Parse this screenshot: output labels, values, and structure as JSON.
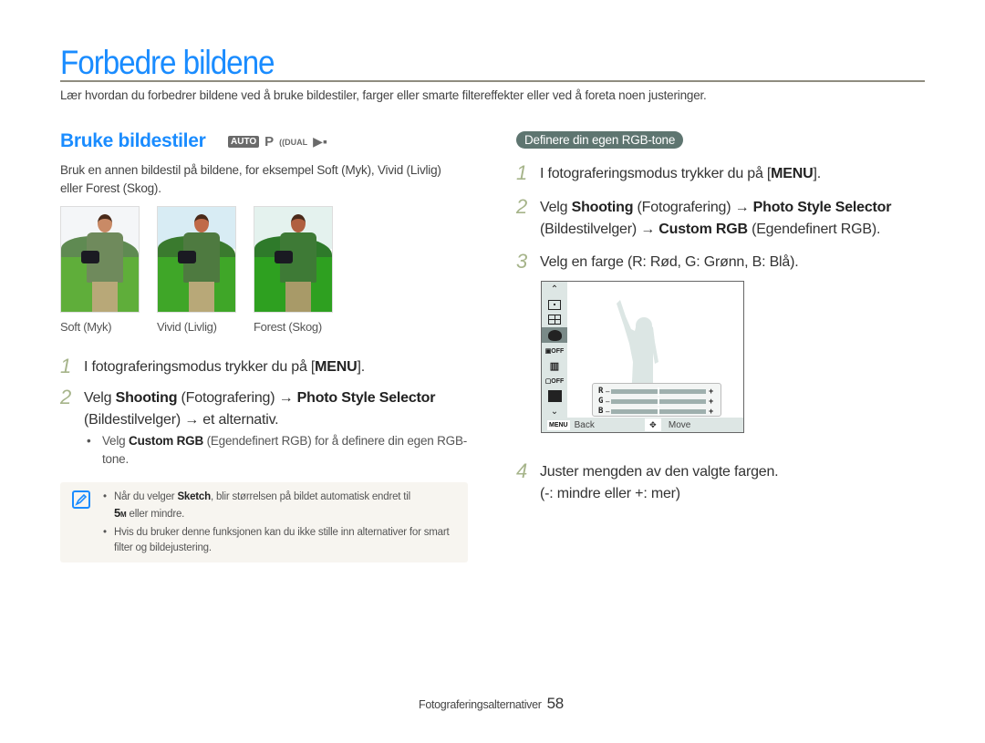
{
  "page": {
    "title": "Forbedre bildene",
    "intro": "Lær hvordan du forbedrer bildene ved å bruke bildestiler, farger eller smarte filtereffekter eller ved å foreta noen justeringer."
  },
  "section": {
    "title": "Bruke bildestiler",
    "mode_icons": [
      "AUTO",
      "P",
      "DUAL",
      "movie"
    ],
    "description": "Bruk en annen bildestil på bildene, for eksempel Soft (Myk), Vivid (Livlig) eller Forest (Skog).",
    "thumbnails": [
      {
        "caption": "Soft (Myk)",
        "style": "soft"
      },
      {
        "caption": "Vivid (Livlig)",
        "style": "vivid"
      },
      {
        "caption": "Forest (Skog)",
        "style": "forest"
      }
    ],
    "steps": [
      {
        "num": "1",
        "pre": "I fotograferingsmodus trykker du på [",
        "bold": "MENU",
        "post": "]."
      },
      {
        "num": "2",
        "a": "Velg ",
        "b": "Shooting",
        "c": " (Fotografering) → ",
        "d": "Photo Style Selector",
        "e": "(Bildestilvelger) → et alternativ."
      }
    ],
    "bullet": {
      "a": "Velg ",
      "b": "Custom RGB",
      "c": " (Egendefinert RGB) for å definere din egen RGB-tone."
    },
    "notes": [
      {
        "a": "Når du velger ",
        "b": "Sketch",
        "c": ", blir størrelsen på bildet automatisk endret til ",
        "res": "5",
        "res_unit": "M",
        "d": " eller mindre."
      },
      {
        "a": "Hvis du bruker denne funksjonen kan du ikke stille inn alternativer for smart filter og bildejustering."
      }
    ]
  },
  "rgb_section": {
    "pill": "Definere din egen RGB-tone",
    "steps": [
      {
        "num": "1",
        "pre": "I fotograferingsmodus trykker du på [",
        "bold": "MENU",
        "post": "]."
      },
      {
        "num": "2",
        "a": "Velg ",
        "b": "Shooting",
        "c": " (Fotografering) → ",
        "d": "Photo Style Selector",
        "e": "(Bildestilvelger) → ",
        "f": "Custom RGB",
        "g": " (Egendefinert RGB)."
      },
      {
        "num": "3",
        "text": "Velg en farge (R: Rød, G: Grønn, B: Blå)."
      },
      {
        "num": "4",
        "line1": "Juster mengden av den valgte fargen.",
        "line2": "(-: mindre eller +: mer)"
      }
    ],
    "lcd": {
      "side_icons": [
        "chevron-up",
        "spot-metering",
        "multi-metering",
        "photo-style",
        "smart-filter-off",
        "image-adjust",
        "face-detect-off",
        "display",
        "chevron-down"
      ],
      "selected_icon": "photo-style",
      "sliders": [
        {
          "label": "R",
          "value": 0.5
        },
        {
          "label": "G",
          "value": 0.5
        },
        {
          "label": "B",
          "value": 0.5
        }
      ],
      "menu_key": "MENU",
      "back_label": "Back",
      "move_label": "Move"
    }
  },
  "footer": {
    "section": "Fotograferingsalternativer",
    "page_number": "58"
  },
  "colors": {
    "accent": "#1a8cff",
    "step_number": "#a6b48a",
    "pill": "#5e7570",
    "note_bg": "#f7f5f0"
  }
}
